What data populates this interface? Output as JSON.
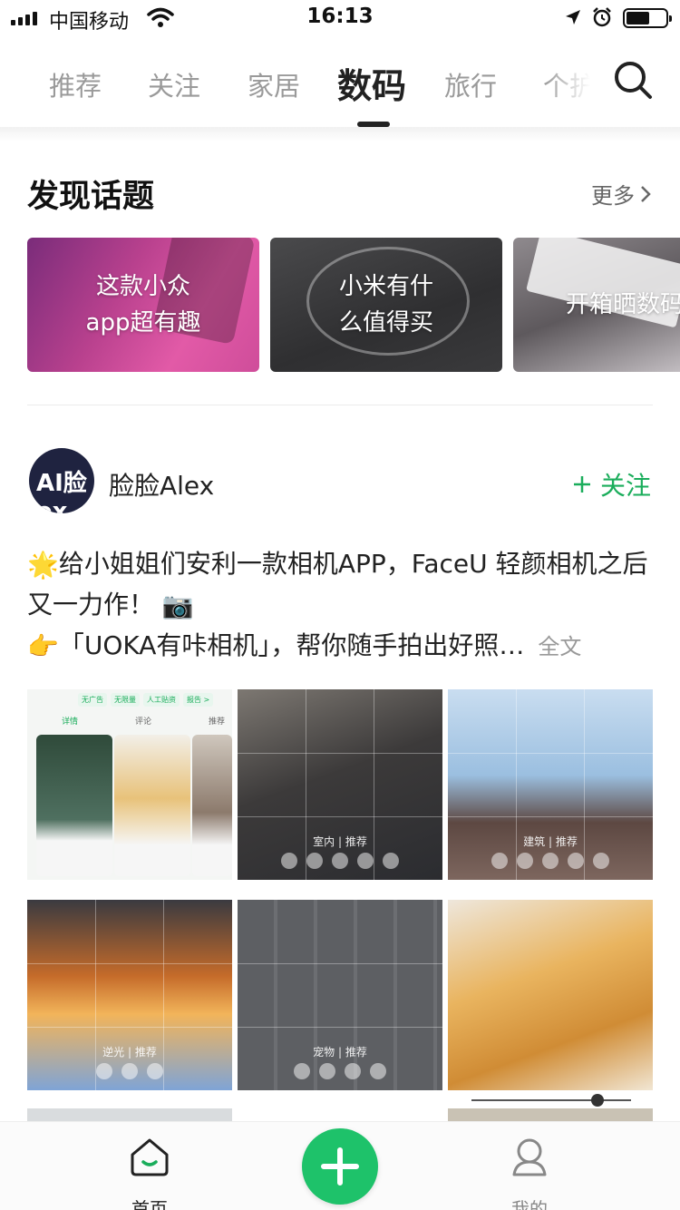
{
  "status_bar": {
    "carrier": "中国移动",
    "time": "16:13",
    "battery_level": 0.6
  },
  "tabs": [
    "推荐",
    "关注",
    "家居",
    "数码",
    "旅行",
    "个护"
  ],
  "active_tab_index": 3,
  "topics": {
    "title": "发现话题",
    "more": "更多",
    "cards": [
      {
        "label": "这款小众\napp超有趣"
      },
      {
        "label": "小米有什\n么值得买"
      },
      {
        "label": "开箱晒数码"
      }
    ]
  },
  "post": {
    "author": "脸脸Alex",
    "avatar_text": "AI脸ex",
    "follow": "关注",
    "line1_emoji": "🌟",
    "line1": "给小姐姐们安利一款相机APP，FaceU 轻颜相机之后 又一力作！",
    "line1_emoji_end": "📷",
    "line2_emoji": "👉",
    "line2": "「UOKA有咔相机」，帮你随手拍出好照…",
    "full_text": "全文",
    "images": [
      {
        "mini_chips": [
          "无广告",
          "无限量",
          "人工贴资",
          "报告 >"
        ],
        "mini_tabs": [
          "详情",
          "评论",
          "推荐"
        ]
      },
      {
        "caption": "室内 | 推荐"
      },
      {
        "caption": "建筑 | 推荐"
      },
      {
        "caption": "逆光 | 推荐"
      },
      {
        "caption": "宠物 | 推荐"
      },
      {
        "caption": ""
      }
    ]
  },
  "tabbar": {
    "home": "首页",
    "me": "我的"
  },
  "colors": {
    "accent": "#1aad5b",
    "add_button": "#1ec26a"
  }
}
